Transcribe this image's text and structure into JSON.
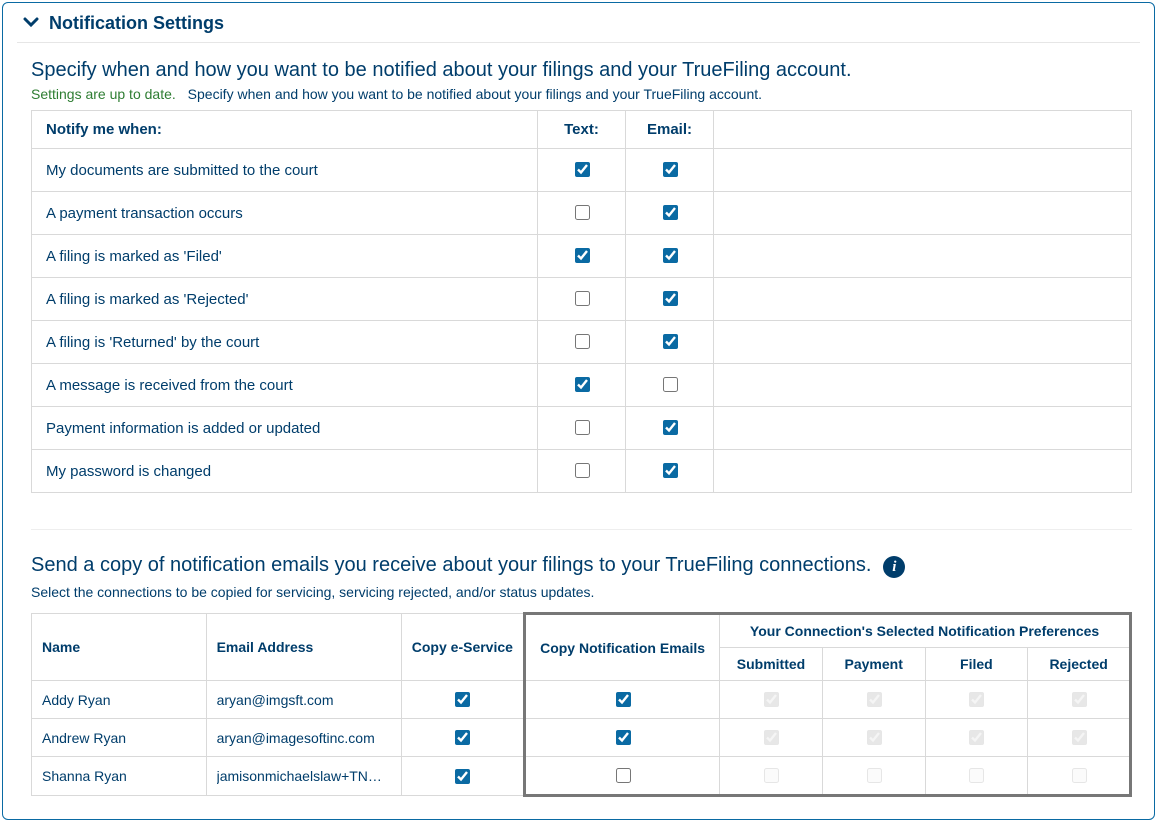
{
  "panel": {
    "title": "Notification Settings"
  },
  "section1": {
    "title": "Specify when and how you want to be notified about your filings and your TrueFiling account.",
    "status": "Settings are up to date.",
    "subdesc": "Specify when and how you want to be notified about your filings and your TrueFiling account.",
    "headers": {
      "notify": "Notify me when:",
      "text": "Text:",
      "email": "Email:"
    },
    "rows": [
      {
        "label": "My documents are submitted to the court",
        "text": true,
        "email": true
      },
      {
        "label": "A payment transaction occurs",
        "text": false,
        "email": true
      },
      {
        "label": "A filing is marked as 'Filed'",
        "text": true,
        "email": true
      },
      {
        "label": "A filing is marked as 'Rejected'",
        "text": false,
        "email": true
      },
      {
        "label": "A filing is 'Returned' by the court",
        "text": false,
        "email": true
      },
      {
        "label": "A message is received from the court",
        "text": true,
        "email": false
      },
      {
        "label": "Payment information is added or updated",
        "text": false,
        "email": true
      },
      {
        "label": "My password is changed",
        "text": false,
        "email": true
      }
    ]
  },
  "section2": {
    "title": "Send a copy of notification emails you receive about your filings to your TrueFiling connections.",
    "desc": "Select the connections to be copied for servicing, servicing rejected, and/or status updates.",
    "headers": {
      "name": "Name",
      "email": "Email Address",
      "copy_eservice": "Copy e-Service",
      "copy_notif": "Copy Notification Emails",
      "prefs_title": "Your Connection's Selected Notification Preferences",
      "submitted": "Submitted",
      "payment": "Payment",
      "filed": "Filed",
      "rejected": "Rejected"
    },
    "rows": [
      {
        "name": "Addy Ryan",
        "email": "aryan@imgsft.com",
        "copy_eservice": true,
        "copy_notif": true,
        "prefs": {
          "submitted": true,
          "payment": true,
          "filed": true,
          "rejected": true
        }
      },
      {
        "name": "Andrew Ryan",
        "email": "aryan@imagesoftinc.com",
        "copy_eservice": true,
        "copy_notif": true,
        "prefs": {
          "submitted": true,
          "payment": true,
          "filed": true,
          "rejected": true
        }
      },
      {
        "name": "Shanna Ryan",
        "email": "jamisonmichaelslaw+TN@...",
        "copy_eservice": true,
        "copy_notif": false,
        "prefs": {
          "submitted": false,
          "payment": false,
          "filed": false,
          "rejected": false
        }
      }
    ]
  }
}
